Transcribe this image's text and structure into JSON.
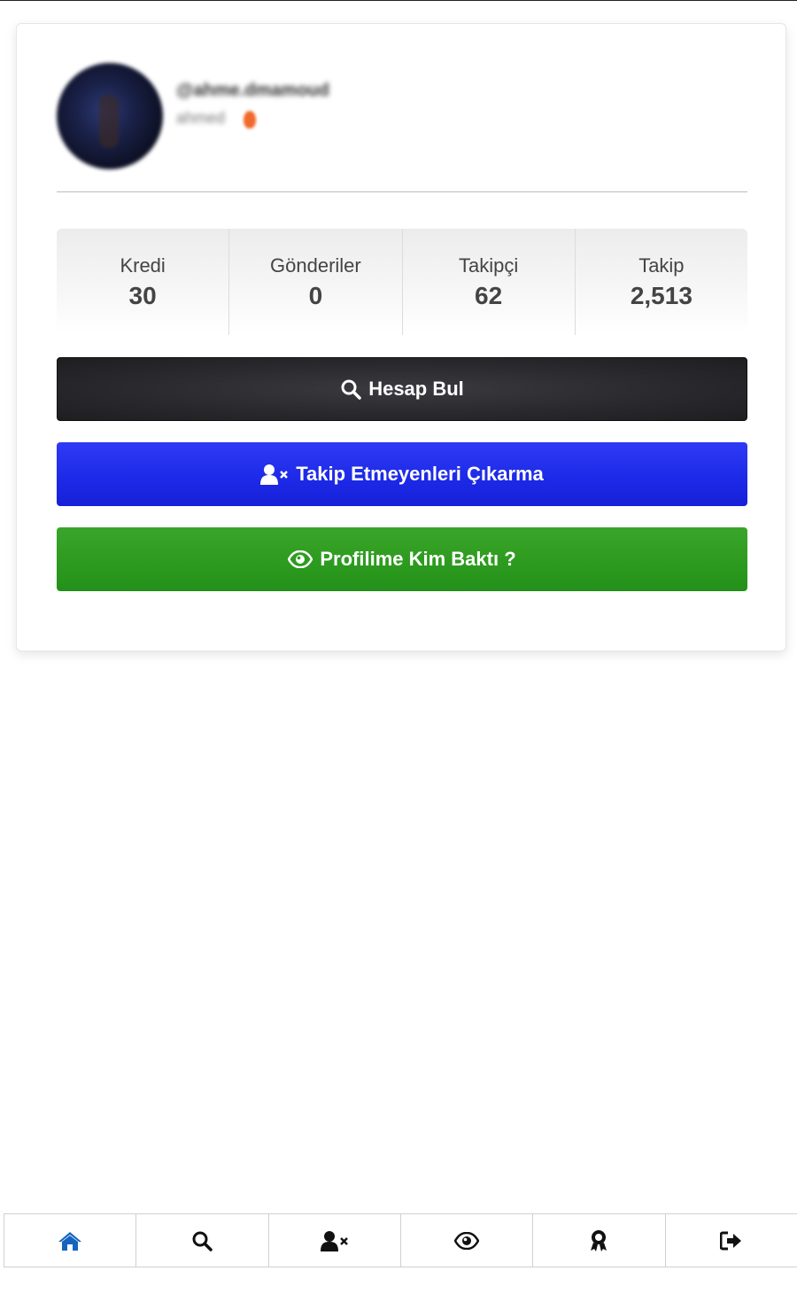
{
  "profile": {
    "username": "@ahme.dmamoud",
    "fullname": "ahmed"
  },
  "stats": [
    {
      "label": "Kredi",
      "value": "30"
    },
    {
      "label": "Gönderiler",
      "value": "0"
    },
    {
      "label": "Takipçi",
      "value": "62"
    },
    {
      "label": "Takip",
      "value": "2,513"
    }
  ],
  "buttons": {
    "find_account": "Hesap Bul",
    "remove_nonfollowers": "Takip Etmeyenleri Çıkarma",
    "profile_viewers": "Profilime Kim Baktı ?"
  },
  "colors": {
    "accent_blue": "#1c29e6",
    "accent_green": "#2c9a1e",
    "dark_button": "#2a2a2e",
    "nav_active": "#1565c0"
  },
  "nav": {
    "items": [
      {
        "icon": "home-icon",
        "active": true
      },
      {
        "icon": "search-icon",
        "active": false
      },
      {
        "icon": "user-remove-icon",
        "active": false
      },
      {
        "icon": "eye-icon",
        "active": false
      },
      {
        "icon": "award-icon",
        "active": false
      },
      {
        "icon": "logout-icon",
        "active": false
      }
    ]
  }
}
